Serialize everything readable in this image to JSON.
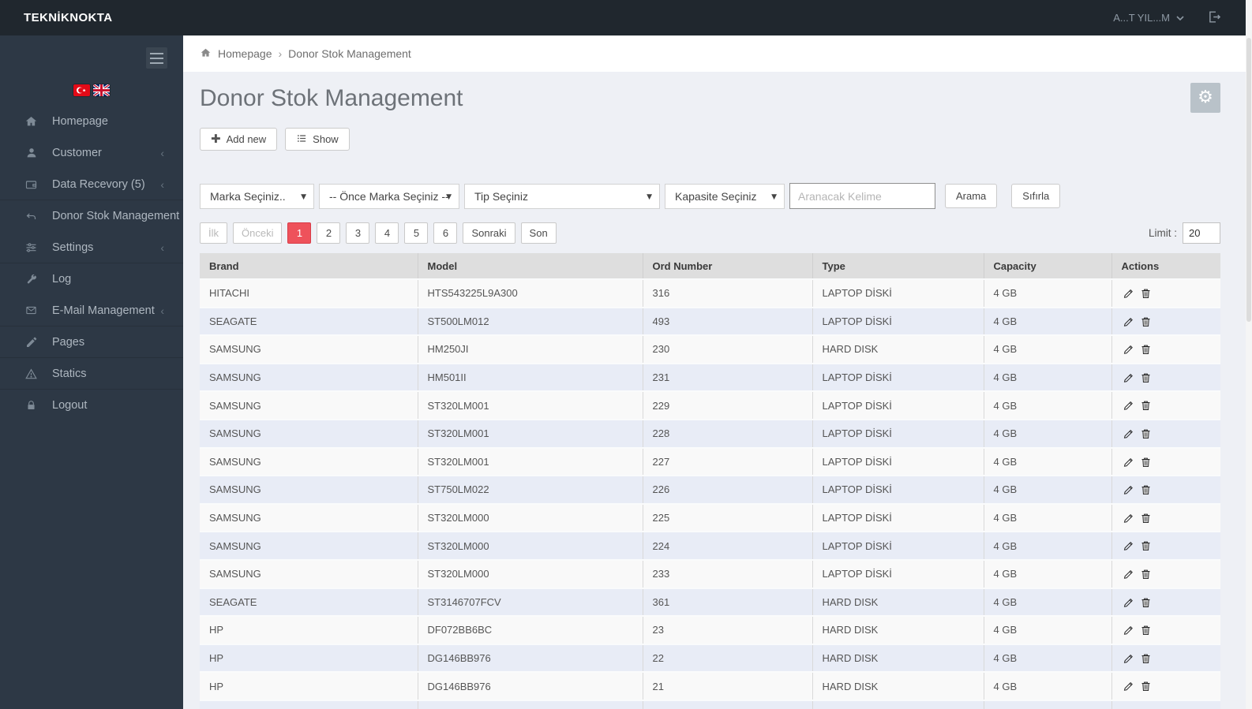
{
  "topbar": {
    "brand": "TEKNİKNOKTA",
    "user": "A...T YIL...M"
  },
  "sidebar": {
    "items": [
      {
        "id": "homepage",
        "label": "Homepage",
        "icon": "home",
        "chevron": false,
        "divider": false
      },
      {
        "id": "customer",
        "label": "Customer",
        "icon": "user",
        "chevron": true,
        "divider": false
      },
      {
        "id": "data-recovery",
        "label": "Data Recevory (5)",
        "icon": "wallet",
        "chevron": true,
        "divider": true
      },
      {
        "id": "donor-stok-management",
        "label": "Donor Stok Management",
        "icon": "undo",
        "chevron": false,
        "divider": false
      },
      {
        "id": "settings",
        "label": "Settings",
        "icon": "sliders",
        "chevron": true,
        "divider": true
      },
      {
        "id": "log",
        "label": "Log",
        "icon": "wrench",
        "chevron": false,
        "divider": false
      },
      {
        "id": "email-management",
        "label": "E-Mail Management",
        "icon": "envelope",
        "chevron": true,
        "divider": true
      },
      {
        "id": "pages",
        "label": "Pages",
        "icon": "pencil",
        "chevron": false,
        "divider": true
      },
      {
        "id": "statics",
        "label": "Statics",
        "icon": "warning",
        "chevron": false,
        "divider": true
      },
      {
        "id": "logout",
        "label": "Logout",
        "icon": "lock",
        "chevron": false,
        "divider": false
      }
    ]
  },
  "breadcrumb": {
    "home": "Homepage",
    "separator": "›",
    "current": "Donor Stok Management"
  },
  "page": {
    "title": "Donor Stok Management"
  },
  "toolbar": {
    "add_new": "Add new",
    "show": "Show"
  },
  "filters": {
    "brand_select": "Marka Seçiniz..",
    "model_select": "-- Önce Marka Seçiniz --",
    "type_select": "Tip Seçiniz",
    "capacity_select": "Kapasite Seçiniz",
    "search_placeholder": "Aranacak Kelime",
    "search_button": "Arama",
    "reset_button": "Sıfırla"
  },
  "pagination": {
    "first": "İlk",
    "prev": "Önceki",
    "pages": [
      "1",
      "2",
      "3",
      "4",
      "5",
      "6"
    ],
    "active": "1",
    "next": "Sonraki",
    "last": "Son",
    "limit_label": "Limit :",
    "limit_value": "20"
  },
  "table": {
    "headers": [
      "Brand",
      "Model",
      "Ord Number",
      "Type",
      "Capacity",
      "Actions"
    ],
    "rows": [
      [
        "HITACHI",
        "HTS543225L9A300",
        "316",
        "LAPTOP DİSKİ",
        "4 GB"
      ],
      [
        "SEAGATE",
        "ST500LM012",
        "493",
        "LAPTOP DİSKİ",
        "4 GB"
      ],
      [
        "SAMSUNG",
        "HM250JI",
        "230",
        "HARD DISK",
        "4 GB"
      ],
      [
        "SAMSUNG",
        "HM501II",
        "231",
        "LAPTOP DİSKİ",
        "4 GB"
      ],
      [
        "SAMSUNG",
        "ST320LM001",
        "229",
        "LAPTOP DİSKİ",
        "4 GB"
      ],
      [
        "SAMSUNG",
        "ST320LM001",
        "228",
        "LAPTOP DİSKİ",
        "4 GB"
      ],
      [
        "SAMSUNG",
        "ST320LM001",
        "227",
        "LAPTOP DİSKİ",
        "4 GB"
      ],
      [
        "SAMSUNG",
        "ST750LM022",
        "226",
        "LAPTOP DİSKİ",
        "4 GB"
      ],
      [
        "SAMSUNG",
        "ST320LM000",
        "225",
        "LAPTOP DİSKİ",
        "4 GB"
      ],
      [
        "SAMSUNG",
        "ST320LM000",
        "224",
        "LAPTOP DİSKİ",
        "4 GB"
      ],
      [
        "SAMSUNG",
        "ST320LM000",
        "233",
        "LAPTOP DİSKİ",
        "4 GB"
      ],
      [
        "SEAGATE",
        "ST3146707FCV",
        "361",
        "HARD DISK",
        "4 GB"
      ],
      [
        "HP",
        "DF072BB6BC",
        "23",
        "HARD DISK",
        "4 GB"
      ],
      [
        "HP",
        "DG146BB976",
        "22",
        "HARD DISK",
        "4 GB"
      ],
      [
        "HP",
        "DG146BB976",
        "21",
        "HARD DISK",
        "4 GB"
      ]
    ]
  },
  "colors": {
    "accent_red": "#ee525b",
    "sidebar_bg": "#2d3845",
    "topbar_bg": "#20272e",
    "row_alt": "#e8ecf6"
  }
}
